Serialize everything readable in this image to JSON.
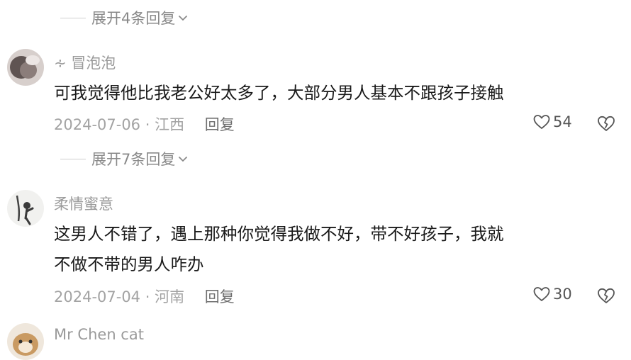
{
  "comments": [
    {
      "username": "",
      "text": "",
      "date": "",
      "location": "",
      "reply_label": "",
      "likes": "",
      "expand_label": "展开4条回复"
    },
    {
      "username": "∻ 冒泡泡",
      "text": "可我觉得他比我老公好太多了，大部分男人基本不跟孩子接触",
      "date": "2024-07-06",
      "location": "江西",
      "reply_label": "回复",
      "likes": "54",
      "expand_label": "展开7条回复"
    },
    {
      "username": "柔情蜜意",
      "text_line1": "这男人不错了，遇上那种你觉得我做不好，带不好孩子，我就",
      "text_line2": "不做不带的男人咋办",
      "date": "2024-07-04",
      "location": "河南",
      "reply_label": "回复",
      "likes": "30"
    },
    {
      "username": "Mr Chen cat"
    }
  ],
  "icons": {
    "like": "heart-outline-icon",
    "dislike": "broken-heart-outline-icon",
    "expand": "chevron-down-icon"
  },
  "colors": {
    "text": "#1a1a1a",
    "secondary": "#a3a3a3",
    "reply": "#6f6f6f"
  }
}
